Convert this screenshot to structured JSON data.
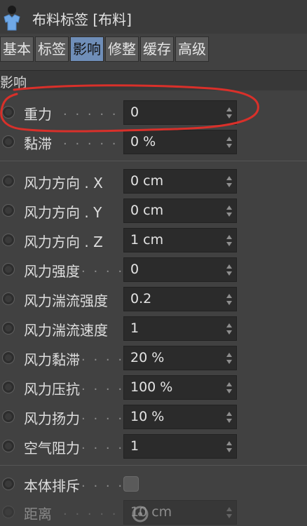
{
  "window": {
    "title": "布料标签 [布料]"
  },
  "tabs": [
    {
      "label": "基本",
      "active": false
    },
    {
      "label": "标签",
      "active": false
    },
    {
      "label": "影响",
      "active": true
    },
    {
      "label": "修整",
      "active": false
    },
    {
      "label": "缓存",
      "active": false
    },
    {
      "label": "高级",
      "active": false
    }
  ],
  "section": {
    "label": "影响"
  },
  "params": [
    {
      "label": "重力",
      "dots": ". . . . . . .",
      "value": "0"
    },
    {
      "label": "黏滞",
      "dots": ". . . . . . .",
      "value": "0 %"
    },
    {
      "label": "风力方向 . X",
      "dots": "",
      "value": "0 cm"
    },
    {
      "label": "风力方向 . Y",
      "dots": "",
      "value": "0 cm"
    },
    {
      "label": "风力方向 . Z",
      "dots": "",
      "value": "1 cm"
    },
    {
      "label": "风力强度",
      "dots": ". . . .",
      "value": "0"
    },
    {
      "label": "风力湍流强度",
      "dots": "",
      "value": "0.2"
    },
    {
      "label": "风力湍流速度",
      "dots": "",
      "value": "1"
    },
    {
      "label": "风力黏滞",
      "dots": ". . . .",
      "value": "20 %"
    },
    {
      "label": "风力压抗",
      "dots": ". . . .",
      "value": "100 %"
    },
    {
      "label": "风力扬力",
      "dots": ". . . .",
      "value": "10 %"
    },
    {
      "label": "空气阻力",
      "dots": ". . . .",
      "value": "1"
    }
  ],
  "self_collision": {
    "label": "本体排斥",
    "dots": ". . . . .",
    "checked": false
  },
  "distance": {
    "label": "距离",
    "dots": ". . . . . . .",
    "value": "10 cm"
  },
  "icons": {
    "tag": "cloth-tag-icon",
    "spinner": "spinner-arrows-icon",
    "radio": "animation-radio-icon"
  },
  "colors": {
    "annotation": "#d9302a",
    "active_tab": "#6f8eb8"
  }
}
